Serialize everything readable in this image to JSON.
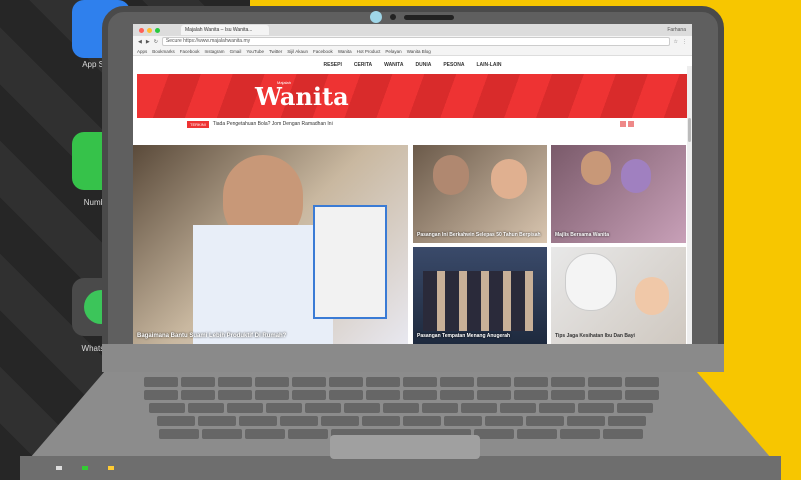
{
  "desktop": {
    "dock": [
      {
        "label": "App Store",
        "color": "#2f80ed"
      },
      {
        "label": "Numbers",
        "color": "#36c24a"
      },
      {
        "label": "WhatsApp",
        "color": "#4a4a4a"
      }
    ]
  },
  "browser": {
    "tab_title": "Majalah Wanita – Isu Wanita...",
    "user": "Farhana",
    "url": "Secure  https://www.majalahwanita.my",
    "bookmarks": [
      "Apps",
      "Bookmarks",
      "Facebook",
      "Instagram",
      "Gmail",
      "YouTube",
      "Twitter",
      "Sijil Akaun",
      "Facebook",
      "Wanita",
      "Hot Product",
      "Pelayan",
      "Wanita Blog"
    ]
  },
  "site": {
    "nav": [
      "RESEPI",
      "CERITA",
      "WANITA",
      "DUNIA",
      "PESONA",
      "LAIN-LAIN"
    ],
    "logo": "Wanita",
    "logo_sup": "Majalah",
    "ticker_label": "TERKINI",
    "ticker_text": "Tiada Pengetahuan Bola? Jom Dengan Ramadhan Ini",
    "tiles": [
      {
        "caption": "Bagaimana Bantu Suami Lebih Produktif Di Rumah?"
      },
      {
        "caption": "Pasangan Ini Berkahwin Selepas 50 Tahun Berpisah"
      },
      {
        "caption": "Pasangan Tempatan Menang Anugerah"
      },
      {
        "caption": "Majlis Bersama Wanita"
      },
      {
        "caption": "Tips Jaga Kesihatan Ibu Dan Bayi"
      }
    ]
  },
  "colors": {
    "accent": "#e33333",
    "yellow": "#f7c600"
  }
}
